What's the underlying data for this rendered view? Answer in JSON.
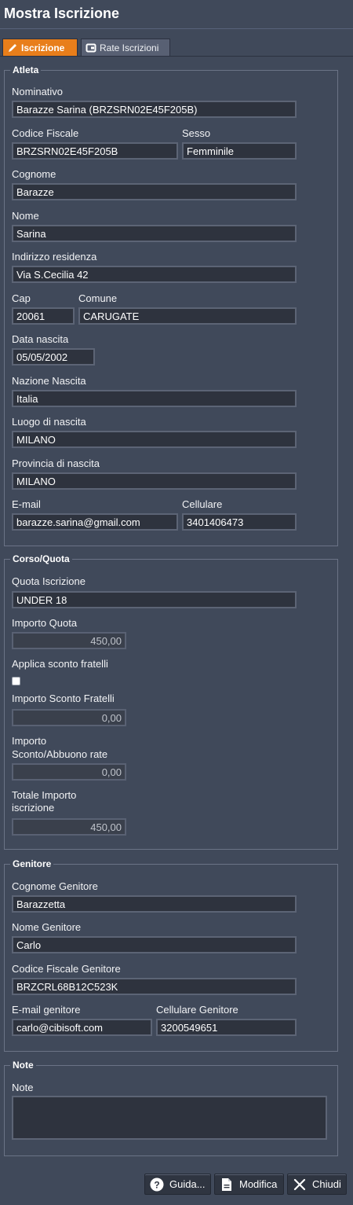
{
  "header": {
    "title": "Mostra Iscrizione"
  },
  "tabs": [
    {
      "label": "Iscrizione",
      "icon": "pencil-icon",
      "active": true
    },
    {
      "label": "Rate Iscrizioni",
      "icon": "wallet-icon",
      "active": false
    }
  ],
  "colors": {
    "accent": "#e87e1b",
    "background": "#40495a",
    "field": "#2e333e"
  },
  "atleta": {
    "legend": "Atleta",
    "nominativo_label": "Nominativo",
    "nominativo": "Barazze Sarina (BRZSRN02E45F205B)",
    "codice_fiscale_label": "Codice Fiscale",
    "codice_fiscale": "BRZSRN02E45F205B",
    "sesso_label": "Sesso",
    "sesso": "Femminile",
    "cognome_label": "Cognome",
    "cognome": "Barazze",
    "nome_label": "Nome",
    "nome": "Sarina",
    "indirizzo_label": "Indirizzo residenza",
    "indirizzo": "Via S.Cecilia 42",
    "cap_label": "Cap",
    "cap": "20061",
    "comune_label": "Comune",
    "comune": "CARUGATE",
    "data_nascita_label": "Data nascita",
    "data_nascita": "05/05/2002",
    "nazione_label": "Nazione Nascita",
    "nazione": "Italia",
    "luogo_label": "Luogo di nascita",
    "luogo": "MILANO",
    "provincia_label": "Provincia di nascita",
    "provincia": "MILANO",
    "email_label": "E-mail",
    "email": "barazze.sarina@gmail.com",
    "cellulare_label": "Cellulare",
    "cellulare": "3401406473"
  },
  "corso": {
    "legend": "Corso/Quota",
    "quota_label": "Quota Iscrizione",
    "quota": "UNDER 18",
    "importo_label": "Importo Quota",
    "importo": "450,00",
    "sconto_fratelli_check_label": "Applica sconto fratelli",
    "sconto_fratelli_checked": false,
    "importo_sconto_label": "Importo Sconto Fratelli",
    "importo_sconto": "0,00",
    "abbuono_label_1": "Importo",
    "abbuono_label_2": "Sconto/Abbuono rate",
    "abbuono": "0,00",
    "totale_label_1": "Totale Importo",
    "totale_label_2": "iscrizione",
    "totale": "450,00"
  },
  "genitore": {
    "legend": "Genitore",
    "cognome_label": "Cognome Genitore",
    "cognome": "Barazzetta",
    "nome_label": "Nome Genitore",
    "nome": "Carlo",
    "cf_label": "Codice Fiscale Genitore",
    "cf": "BRZCRL68B12C523K",
    "email_label": "E-mail genitore",
    "email": "carlo@cibisoft.com",
    "cellulare_label": "Cellulare Genitore",
    "cellulare": "3200549651"
  },
  "note": {
    "legend": "Note",
    "label": "Note",
    "value": ""
  },
  "footer": {
    "guida": {
      "label": "Guida...",
      "icon": "help-icon"
    },
    "modifica": {
      "label": "Modifica",
      "icon": "document-icon"
    },
    "chiudi": {
      "label": "Chiudi",
      "icon": "close-icon"
    }
  }
}
